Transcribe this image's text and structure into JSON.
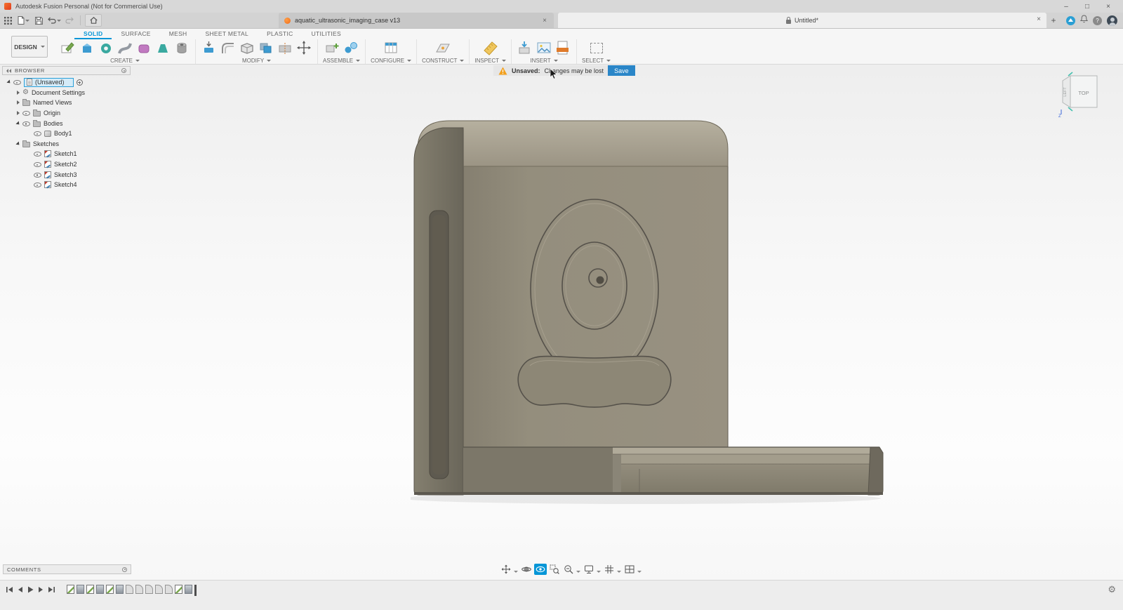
{
  "colors": {
    "accent": "#0696d7",
    "warning_orange": "#f2a01e",
    "save_blue": "#2a86c8"
  },
  "glyphs": {
    "close": "×",
    "minimize": "–",
    "maximize": "□",
    "plus": "+",
    "help": "?",
    "gear": "⚙"
  },
  "titlebar": {
    "title": "Autodesk Fusion Personal (Not for Commercial Use)"
  },
  "docbar": {
    "active_tab": "aquatic_ultrasonic_imaging_case v13",
    "inactive_tab": "Untitled*"
  },
  "ribbon": {
    "design": "DESIGN",
    "tabs": [
      "SOLID",
      "SURFACE",
      "MESH",
      "SHEET METAL",
      "PLASTIC",
      "UTILITIES"
    ],
    "active_tab": "SOLID",
    "groups": [
      "CREATE",
      "MODIFY",
      "ASSEMBLE",
      "CONFIGURE",
      "CONSTRUCT",
      "INSPECT",
      "INSERT",
      "SELECT"
    ]
  },
  "browser": {
    "title": "BROWSER",
    "root_label": "(Unsaved)",
    "items": [
      "Document Settings",
      "Named Views",
      "Origin",
      "Bodies",
      "Body1",
      "Sketches",
      "Sketch1",
      "Sketch2",
      "Sketch3",
      "Sketch4"
    ]
  },
  "warning": {
    "label": "Unsaved:",
    "message": "Changes may be lost",
    "action": "Save"
  },
  "viewcube": {
    "top": "TOP",
    "left": "LEFT",
    "axis": "Z"
  },
  "comments": {
    "title": "COMMENTS"
  },
  "timeline": {
    "features": [
      "sketch",
      "extrude",
      "sketch",
      "extrude",
      "sketch",
      "extrude",
      "fillet",
      "fillet",
      "fillet",
      "fillet",
      "fillet",
      "sketch",
      "extrude"
    ]
  }
}
